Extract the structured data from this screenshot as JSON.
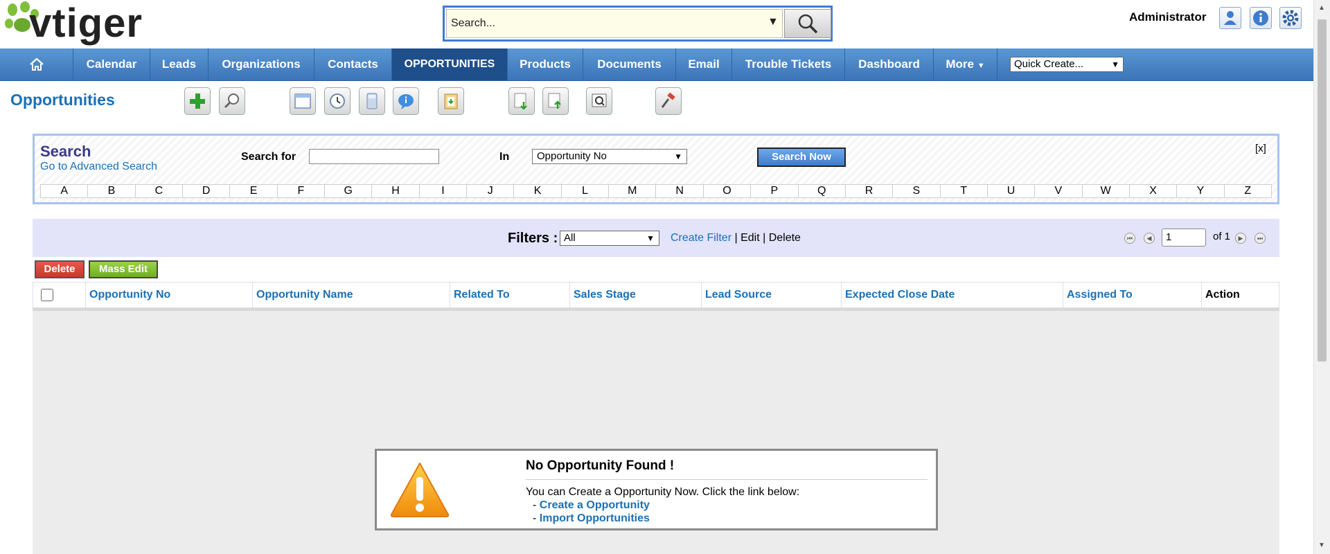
{
  "header": {
    "logo_text": "vtiger",
    "search_placeholder": "Search...",
    "user": "Administrator",
    "icons": [
      "user-preferences-icon",
      "info-icon",
      "settings-gear-icon"
    ]
  },
  "nav": {
    "items": [
      "Calendar",
      "Leads",
      "Organizations",
      "Contacts",
      "OPPORTUNITIES",
      "Products",
      "Documents",
      "Email",
      "Trouble Tickets",
      "Dashboard",
      "More"
    ],
    "active": "OPPORTUNITIES",
    "quick_create": "Quick Create..."
  },
  "module": {
    "title": "Opportunities",
    "toolbar_icons": [
      "add-icon",
      "search-icon",
      "calendar-icon",
      "clock-icon",
      "calculator-icon",
      "chat-icon",
      "clipboard-icon",
      "import-icon",
      "export-icon",
      "find-duplicates-icon",
      "settings-hammer-icon"
    ]
  },
  "search_panel": {
    "title": "Search",
    "advanced_link": "Go to Advanced Search",
    "search_for_label": "Search for",
    "search_value": "",
    "in_label": "In",
    "in_selected": "Opportunity No",
    "search_button": "Search Now",
    "close": "[x]",
    "alphabet": [
      "A",
      "B",
      "C",
      "D",
      "E",
      "F",
      "G",
      "H",
      "I",
      "J",
      "K",
      "L",
      "M",
      "N",
      "O",
      "P",
      "Q",
      "R",
      "S",
      "T",
      "U",
      "V",
      "W",
      "X",
      "Y",
      "Z"
    ]
  },
  "filters": {
    "label": "Filters :",
    "selected": "All",
    "create": "Create Filter",
    "sep1": " | ",
    "edit": "Edit",
    "sep2": " | ",
    "delete": "Delete",
    "page": "1",
    "of": "of 1"
  },
  "list": {
    "delete_button": "Delete",
    "mass_edit_button": "Mass Edit",
    "columns": [
      "Opportunity No",
      "Opportunity Name",
      "Related To",
      "Sales Stage",
      "Lead Source",
      "Expected Close Date",
      "Assigned To",
      "Action"
    ]
  },
  "empty_state": {
    "title": "No Opportunity Found !",
    "message": "You can Create a Opportunity Now. Click the link below:",
    "dash": "- ",
    "link_create": "Create a Opportunity",
    "link_import": "Import Opportunities"
  },
  "colors": {
    "nav_blue": "#3b74b8",
    "link_blue": "#1a70b5",
    "delete_red": "#c8392b",
    "mass_edit_green": "#6fae20",
    "filter_bg": "#e3e3fa"
  }
}
